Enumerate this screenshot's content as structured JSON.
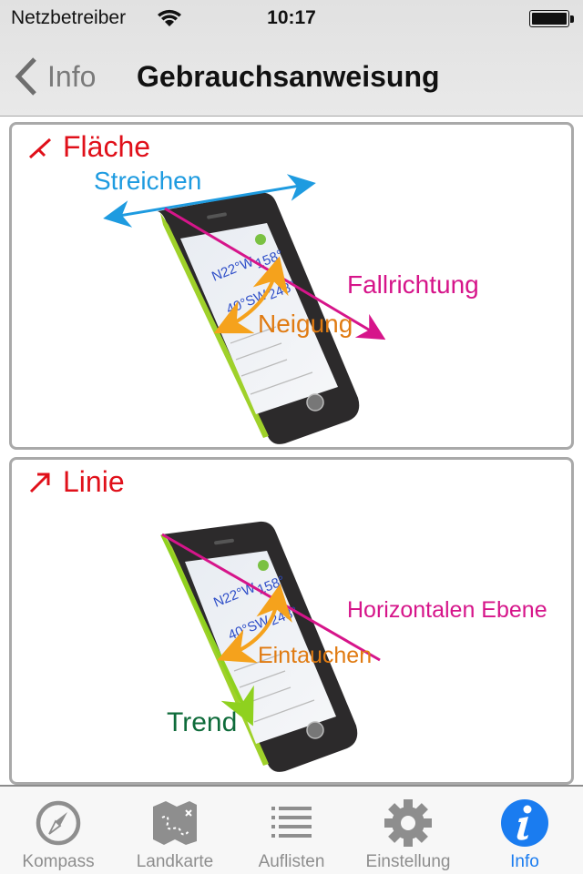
{
  "status_bar": {
    "carrier": "Netzbetreiber",
    "time": "10:17",
    "battery_percent": 100
  },
  "nav_bar": {
    "back_label": "Info",
    "title": "Gebrauchsanweisung"
  },
  "panels": [
    {
      "title": "Fläche",
      "icon": "plane-strike-dip-icon",
      "labels": {
        "strike": "Streichen",
        "dip_direction": "Fallrichtung",
        "dip": "Neigung"
      },
      "phone_screen": {
        "strike_value": "N22°W",
        "strike_angle": "158°",
        "dip_value": "40°SW",
        "dip_angle": "248°"
      }
    },
    {
      "title": "Linie",
      "icon": "line-arrow-icon",
      "labels": {
        "horizontal_plane": "Horizontalen Ebene",
        "plunge": "Eintauchen",
        "trend": "Trend"
      },
      "phone_screen": {
        "strike_value": "N22°W",
        "strike_angle": "158°",
        "dip_value": "40°SW",
        "dip_angle": "248°"
      }
    }
  ],
  "colors": {
    "title_red": "#e0101a",
    "strike_blue": "#1e9be0",
    "dip_magenta": "#d6158a",
    "dip_orange": "#f5a21c",
    "trend_green": "#0e6b3a",
    "trend_line": "#8fd11f",
    "active_tab": "#1a7cf0",
    "inactive_tab": "#8e8e8e"
  },
  "tab_bar": {
    "tabs": [
      {
        "label": "Kompass",
        "icon": "compass-icon",
        "active": false
      },
      {
        "label": "Landkarte",
        "icon": "map-icon",
        "active": false
      },
      {
        "label": "Auflisten",
        "icon": "list-icon",
        "active": false
      },
      {
        "label": "Einstellung",
        "icon": "gear-icon",
        "active": false
      },
      {
        "label": "Info",
        "icon": "info-icon",
        "active": true
      }
    ]
  }
}
